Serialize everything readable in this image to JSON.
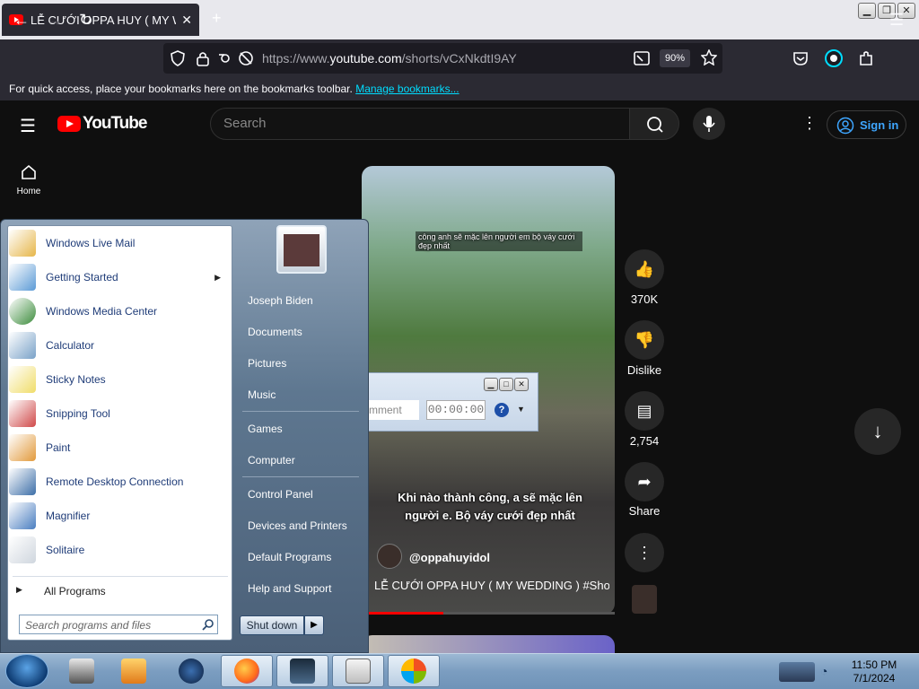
{
  "browser": {
    "tab_title": "LỄ CƯỚI OPPA HUY ( MY WEDDI",
    "tab_close": "✕",
    "new_tab": "+",
    "url_prefix": "https://www.",
    "url_domain": "youtube.com",
    "url_path": "/shorts/vCxNkdtI9AY",
    "zoom": "90%",
    "bookmarks_text": "For quick access, place your bookmarks here on the bookmarks toolbar.",
    "bookmarks_link": "Manage bookmarks..."
  },
  "youtube": {
    "logo_text": "YouTube",
    "search_placeholder": "Search",
    "signin": "Sign in",
    "home_label": "Home",
    "video": {
      "overlay_text": "công anh sẽ mặc lên người em bộ váy cưới đẹp nhất",
      "caption": "Khi nào thành công, a sẽ mặc lên người e. Bộ váy cưới đẹp nhất",
      "channel": "@oppahuyidol",
      "title": "LỄ CƯỚI OPPA HUY ( MY WEDDING ) #Shorts"
    },
    "actions": {
      "likes": "370K",
      "dislike": "Dislike",
      "comments": "2,754",
      "share": "Share"
    }
  },
  "start_menu": {
    "programs": [
      {
        "label": "Windows Live Mail",
        "color": "#e6b64a"
      },
      {
        "label": "Getting Started",
        "color": "#5c9bd6"
      },
      {
        "label": "Windows Media Center",
        "color": "#3c8c3c"
      },
      {
        "label": "Calculator",
        "color": "#7aa2c8"
      },
      {
        "label": "Sticky Notes",
        "color": "#f0dd6a"
      },
      {
        "label": "Snipping Tool",
        "color": "#d04a4a"
      },
      {
        "label": "Paint",
        "color": "#e29a3c"
      },
      {
        "label": "Remote Desktop Connection",
        "color": "#3d6fa8"
      },
      {
        "label": "Magnifier",
        "color": "#4a7ec0"
      },
      {
        "label": "Solitaire",
        "color": "#cfd6de"
      }
    ],
    "all_programs": "All Programs",
    "search_placeholder": "Search programs and files",
    "places": [
      "Joseph Biden",
      "Documents",
      "Pictures",
      "Music",
      "Games",
      "Computer",
      "Control Panel",
      "Devices and Printers",
      "Default Programs",
      "Help and Support"
    ],
    "shutdown": "Shut down"
  },
  "dialog": {
    "comment_text": "mment",
    "time": "00:00:00"
  },
  "taskbar": {
    "time": "11:50 PM",
    "date": "7/1/2024"
  }
}
